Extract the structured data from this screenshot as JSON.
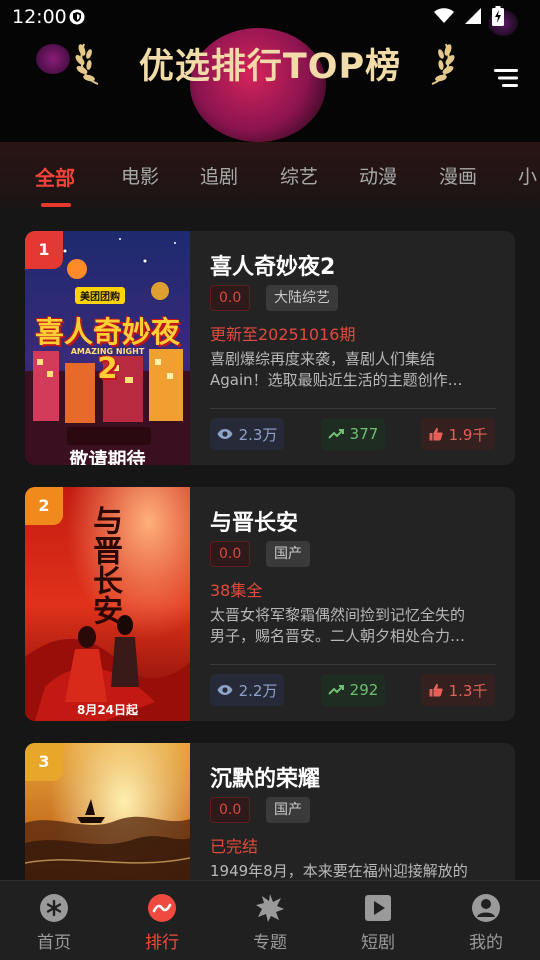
{
  "status_bar": {
    "time": "12:00"
  },
  "header": {
    "title": "优选排行TOP榜"
  },
  "tabs": [
    {
      "label": "全部",
      "active": true
    },
    {
      "label": "电影",
      "active": false
    },
    {
      "label": "追剧",
      "active": false
    },
    {
      "label": "综艺",
      "active": false
    },
    {
      "label": "动漫",
      "active": false
    },
    {
      "label": "漫画",
      "active": false
    },
    {
      "label": "小",
      "active": false
    }
  ],
  "items": [
    {
      "rank": "1",
      "rank_color": "#e23a33",
      "title": "喜人奇妙夜2",
      "score": "0.0",
      "tag": "大陆综艺",
      "update": "更新至20251016期",
      "desc_line1": "喜剧爆综再度来袭，喜剧人们集结",
      "desc_line2": "Again！选取最贴近生活的主题创作…",
      "views": "2.3万",
      "trend": "377",
      "likes": "1.9千",
      "poster": {
        "badge": "美团团购",
        "title_art": "喜人奇妙夜2",
        "subtitle": "AMAZING NIGHT",
        "footer": "敬请期待"
      }
    },
    {
      "rank": "2",
      "rank_color": "#f08a1c",
      "title": "与晋长安",
      "score": "0.0",
      "tag": "国产",
      "update": "38集全",
      "desc_line1": "太晋女将军黎霜偶然间捡到记忆全失的",
      "desc_line2": "男子，赐名晋安。二人朝夕相处合力…",
      "views": "2.2万",
      "trend": "292",
      "likes": "1.3千",
      "poster": {
        "title_art": "与晋长安",
        "footer": "8月24日起"
      }
    },
    {
      "rank": "3",
      "rank_color": "#e8a62a",
      "title": "沉默的荣耀",
      "score": "0.0",
      "tag": "国产",
      "update": "已完结",
      "desc_line1": "1949年8月，本来要在福州迎接解放的",
      "desc_line2": "",
      "views": "",
      "trend": "",
      "likes": "",
      "poster": {}
    }
  ],
  "bottom_nav": [
    {
      "label": "首页",
      "icon": "asterisk-circle-icon",
      "active": false
    },
    {
      "label": "排行",
      "icon": "trend-circle-icon",
      "active": true
    },
    {
      "label": "专题",
      "icon": "starburst-icon",
      "active": false
    },
    {
      "label": "短剧",
      "icon": "play-square-icon",
      "active": false
    },
    {
      "label": "我的",
      "icon": "user-circle-icon",
      "active": false
    }
  ],
  "colors": {
    "accent": "#e8392f",
    "header_title": "#f1dba8",
    "card_bg": "#232323",
    "page_bg": "#161616"
  }
}
